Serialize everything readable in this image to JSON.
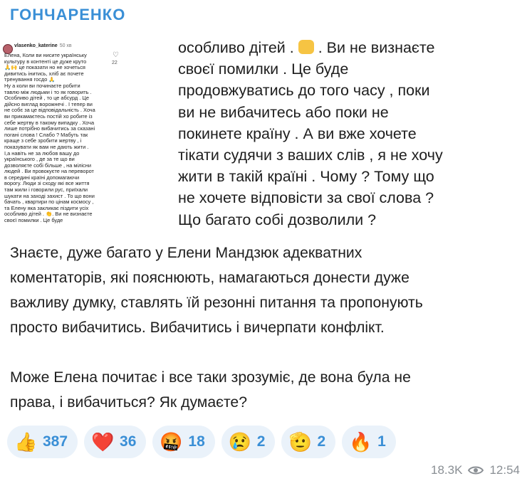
{
  "channel": {
    "name": "ГОНЧАРЕНКО"
  },
  "media": {
    "left_screenshot": {
      "username": "vlasenko_katerine",
      "time": "50 хв",
      "likes": "22",
      "lines": [
        "Елена, Коли ви нисите українську",
        "культуру в контенті це дуже круто",
        "🙏🙌 це показати но не хочеться",
        "дивитись інитись, хліб ає почете",
        "тренування госдо 🙏",
        "Ну а коли ви починаєте робити",
        "тавлю між людьми і то як говорить .",
        "Особливо дітей , то це абсурд . Це",
        "дійсно виглад ворожнечі . І тепер ви",
        "не собє за це відповідальність . Хоча",
        "ви прикамаєтесь постій хо робите із",
        "себе жертву в такому випадку . Хоча",
        "лише потрібно вибачитись за сказані",
        "погані слова ! Слабо ? Мабуть так",
        "краще з себе зробити жертву , і",
        "показувати як вам не дають жити .",
        "І,а навіть не за любов вашу до",
        "українського , де за те що ви",
        "дозволяєте собі більше , на мілісни",
        "людей . Ви провокуєте на переворот",
        "в середині країні допомагаючи",
        "ворогу. Люди зі сходу які все життя",
        "там жили і говорили рус, приїхали",
        "шукати на заході захист . То що вони",
        "бачать , квартири по цінам космосу ,",
        "та Елену яка закликає піздити усіх",
        "особливо дітей . 👏. Ви не визнаєте",
        "своєї помилки . Це буде"
      ]
    },
    "zoomed_screenshot": {
      "lines": [
        "особливо дітей .",
        ". Ви не визнаєте",
        "своєї помилки . Це буде",
        "продовжуватись до того часу , поки",
        "ви не вибачитесь або поки не",
        "покинете країну . А ви вже хочете",
        "тікати судячи з ваших слів , я не хочу",
        "жити в такій країні . Чому ? Тому що",
        "не хочете відповісти за свої слова ?",
        "Що  багато собі дозволили ?"
      ]
    }
  },
  "message": {
    "paragraph1": [
      "Знаєте, дуже багато у Елени Мандзюк адекватних",
      "коментаторів, які пояснюють, намагаються донести дуже",
      "важливу думку, ставлять їй резонні питання та пропонують",
      "просто вибачитись. Вибачитись і вичерпати конфлікт."
    ],
    "paragraph2": [
      "Може Елена почитає і все таки зрозуміє, де вона була не",
      "права, і вибачиться? Як думаєте?"
    ]
  },
  "reactions": [
    {
      "emoji": "👍",
      "icon": "thumbs-up-icon",
      "count": "387"
    },
    {
      "emoji": "❤️",
      "icon": "heart-icon",
      "count": "36"
    },
    {
      "emoji": "🤬",
      "icon": "swearing-face-icon",
      "count": "18"
    },
    {
      "emoji": "😢",
      "icon": "crying-face-icon",
      "count": "2"
    },
    {
      "emoji": "🫡",
      "icon": "salute-icon",
      "count": "2"
    },
    {
      "emoji": "🔥",
      "icon": "fire-icon",
      "count": "1"
    }
  ],
  "footer": {
    "views": "18.3K",
    "time": "12:54"
  },
  "colors": {
    "accent": "#3a8fd6",
    "reaction_bg": "#eaf2fa",
    "meta": "#8a8f94"
  }
}
